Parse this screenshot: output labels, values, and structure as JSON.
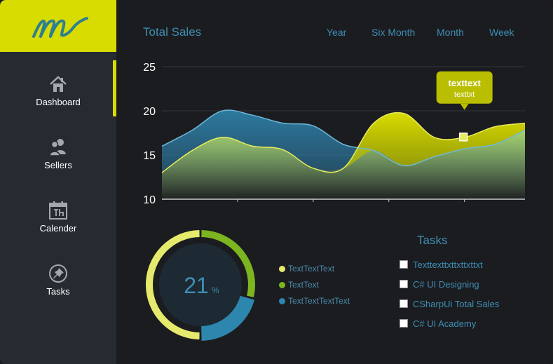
{
  "logo": {
    "glyph": "m"
  },
  "sidebar": {
    "items": [
      {
        "label": "Dashboard",
        "icon": "home-icon",
        "active": true
      },
      {
        "label": "Sellers",
        "icon": "users-icon",
        "active": false
      },
      {
        "label": "Calender",
        "icon": "calendar-icon",
        "active": false
      },
      {
        "label": "Tasks",
        "icon": "pin-icon",
        "active": false
      }
    ]
  },
  "header": {
    "title": "Total Sales",
    "ranges": [
      "Year",
      "Six Month",
      "Month",
      "Week"
    ]
  },
  "tooltip": {
    "title": "texttext",
    "subtitle": "texttxt",
    "value": 17
  },
  "chart_data": {
    "type": "area",
    "ylim": [
      10,
      25
    ],
    "yticks": [
      10,
      15,
      20,
      25
    ],
    "grid": true,
    "series": [
      {
        "color": "#3e8fb4",
        "x": [
          0,
          1,
          2,
          3,
          4,
          5,
          6,
          7,
          8,
          9,
          10,
          11,
          12
        ],
        "values": [
          16,
          17.8,
          20,
          19.5,
          18.6,
          18.3,
          16.2,
          15.5,
          13.8,
          14.8,
          15.7,
          16.2,
          17.8
        ]
      },
      {
        "color": "#d9dc00",
        "x": [
          0,
          1,
          2,
          3,
          4,
          5,
          6,
          7,
          8,
          9,
          10,
          11,
          12
        ],
        "values": [
          13,
          15.5,
          17,
          16,
          15.6,
          13.5,
          13.5,
          18.6,
          19.7,
          17,
          17,
          18.2,
          18.6
        ]
      }
    ]
  },
  "donut": {
    "value_text": "21",
    "unit": "%",
    "segments": [
      {
        "name": "TextTextText",
        "color": "#e6ea6c",
        "fraction": 0.5
      },
      {
        "name": "TextText",
        "color": "#7cb51f",
        "fraction": 0.29
      },
      {
        "name": "TextTextTextText",
        "color": "#2d86ad",
        "fraction": 0.21
      }
    ]
  },
  "tasks": {
    "title": "Tasks",
    "items": [
      "Texttexttxttxttxttxt",
      "C# UI Designing",
      "CSharpUi Total Sales",
      "C# UI Academy"
    ]
  }
}
